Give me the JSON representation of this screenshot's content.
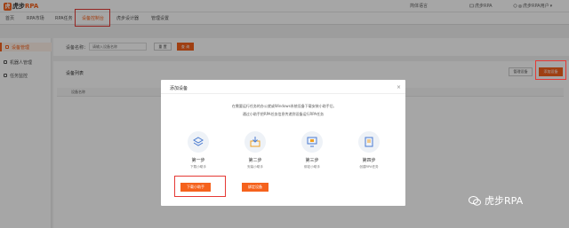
{
  "app": {
    "logo_mark": "虎",
    "logo_text": "虎步",
    "logo_suffix": "RPA"
  },
  "topbar": {
    "language": "简体语言",
    "product": "虎步RPA",
    "user": "虎步RPA用户"
  },
  "nav": {
    "items": [
      {
        "label": "首页"
      },
      {
        "label": "RPA市场"
      },
      {
        "label": "RPA任务"
      },
      {
        "label": "设备控制台"
      },
      {
        "label": "虎步设计器"
      },
      {
        "label": "管理设置"
      }
    ],
    "active_index": 3
  },
  "sidebar": {
    "items": [
      {
        "label": "设备管理"
      },
      {
        "label": "机器人管理"
      },
      {
        "label": "任务监控"
      }
    ]
  },
  "filter": {
    "label": "设备名称：",
    "placeholder": "请输入设备名称",
    "reset_label": "重 置",
    "search_label": "查 询"
  },
  "list": {
    "title": "设备列表",
    "column_name": "设备名称",
    "manage_label": "管理设备",
    "add_label": "添加设备"
  },
  "modal": {
    "title": "添加设备",
    "close": "×",
    "desc1": "在需要运行任务的办公就或Windows系统设备下载安装小助手后,",
    "desc2": "通过小助手把RPA任务信息传递到设备运行RPA任务",
    "steps": [
      {
        "title": "第一步",
        "sub": "下载小助手",
        "icon": "layers-icon"
      },
      {
        "title": "第二步",
        "sub": "安装小助手",
        "icon": "install-icon"
      },
      {
        "title": "第三步",
        "sub": "绑定小助手",
        "icon": "monitor-icon"
      },
      {
        "title": "第四步",
        "sub": "创建RPA任务",
        "icon": "document-icon"
      }
    ],
    "download_label": "下载小助手",
    "bind_label": "绑定设备"
  },
  "watermark": {
    "text": "虎步RPA"
  },
  "colors": {
    "accent": "#f5621d",
    "highlight": "#e53935"
  }
}
